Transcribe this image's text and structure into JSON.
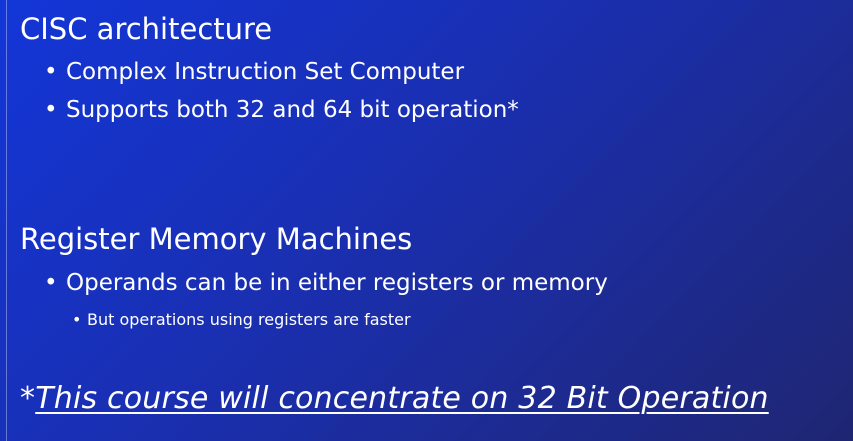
{
  "slide": {
    "section1": {
      "title": "CISC architecture",
      "bullets": [
        "Complex Instruction Set Computer",
        "Supports both 32 and 64 bit operation*"
      ]
    },
    "section2": {
      "title": "Register Memory Machines",
      "bullets": [
        "Operands can be in either registers or memory"
      ],
      "sub_bullets": [
        "But operations using registers are faster"
      ]
    },
    "note": {
      "prefix": "*",
      "text": "This course will concentrate on 32 Bit Operation"
    },
    "bullet_glyph": "•"
  },
  "colors": {
    "background_start": "#1336d8",
    "background_end": "#1e2672",
    "text": "#ffffff"
  }
}
